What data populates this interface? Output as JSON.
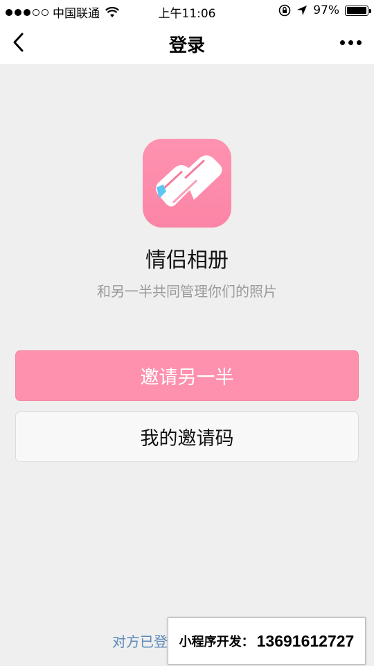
{
  "status_bar": {
    "carrier": "中国联通",
    "time": "上午11:06",
    "battery": "97%",
    "battery_level": 0.97,
    "signal_strength": 3,
    "signal_max": 5
  },
  "nav": {
    "title": "登录",
    "back_icon": "chevron-left-icon",
    "more_icon": "more-dots-icon"
  },
  "app": {
    "name": "情侣相册",
    "subtitle": "和另一半共同管理你们的照片",
    "logo_icon": "heart-book-icon",
    "brand_color": "#fd91ae"
  },
  "buttons": {
    "invite_label": "邀请另一半",
    "code_label": "我的邀请码"
  },
  "footer": {
    "link_text": "对方已登"
  },
  "contact": {
    "label": "小程序开发：",
    "number": "13691612727"
  }
}
